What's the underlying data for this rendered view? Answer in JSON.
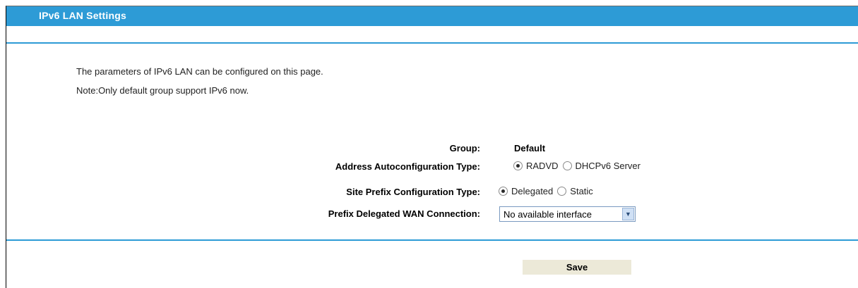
{
  "title": "IPv6 LAN Settings",
  "description": {
    "line1": "The parameters of IPv6 LAN can be configured on this page.",
    "line2": "Note:Only default group support IPv6 now."
  },
  "form": {
    "group": {
      "label": "Group:",
      "value": "Default"
    },
    "address_autoconfig": {
      "label": "Address Autoconfiguration Type:",
      "options": [
        {
          "label": "RADVD",
          "checked": true
        },
        {
          "label": "DHCPv6 Server",
          "checked": false
        }
      ]
    },
    "site_prefix": {
      "label": "Site Prefix Configuration Type:",
      "options": [
        {
          "label": "Delegated",
          "checked": true
        },
        {
          "label": "Static",
          "checked": false
        }
      ]
    },
    "prefix_wan": {
      "label": "Prefix Delegated WAN Connection:",
      "selected": "No available interface"
    }
  },
  "actions": {
    "save_label": "Save"
  },
  "colors": {
    "accent": "#2d9bd6",
    "button_bg": "#ece9d8"
  }
}
